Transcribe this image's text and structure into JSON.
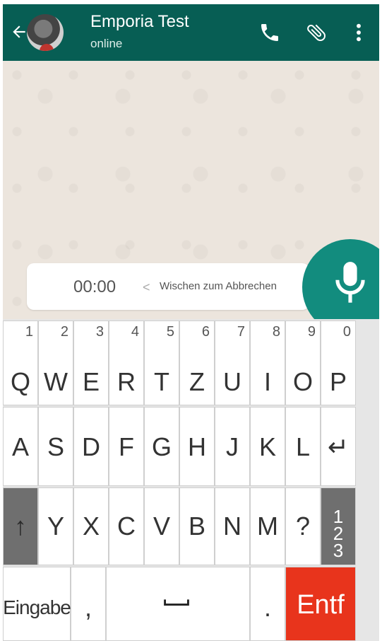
{
  "header": {
    "contact_name": "Emporia Test",
    "status": "online",
    "icons": [
      "back-arrow-icon",
      "phone-icon",
      "attach-icon",
      "more-vert-icon"
    ]
  },
  "recording": {
    "timer": "00:00",
    "swipe_hint_arrow": "<",
    "swipe_hint": "Wischen zum Abbrechen",
    "mic_color": "#128c7e"
  },
  "keyboard": {
    "row1": [
      {
        "label": "Q",
        "num": "1"
      },
      {
        "label": "W",
        "num": "2"
      },
      {
        "label": "E",
        "num": "3"
      },
      {
        "label": "R",
        "num": "4"
      },
      {
        "label": "T",
        "num": "5"
      },
      {
        "label": "Z",
        "num": "6"
      },
      {
        "label": "U",
        "num": "7"
      },
      {
        "label": "I",
        "num": "8"
      },
      {
        "label": "O",
        "num": "9"
      },
      {
        "label": "P",
        "num": "0"
      }
    ],
    "row2": [
      "A",
      "S",
      "D",
      "F",
      "G",
      "H",
      "J",
      "K",
      "L",
      "↵"
    ],
    "row3": [
      "↑",
      "Y",
      "X",
      "C",
      "V",
      "B",
      "N",
      "M",
      "?",
      "1\n2\n3"
    ],
    "row4": {
      "enter": "Eingabe",
      "comma": ",",
      "period": ".",
      "delete": "Entf"
    }
  },
  "colors": {
    "header": "#075e54",
    "delete_key": "#e8341c",
    "shift_key": "#6f6f6f"
  }
}
